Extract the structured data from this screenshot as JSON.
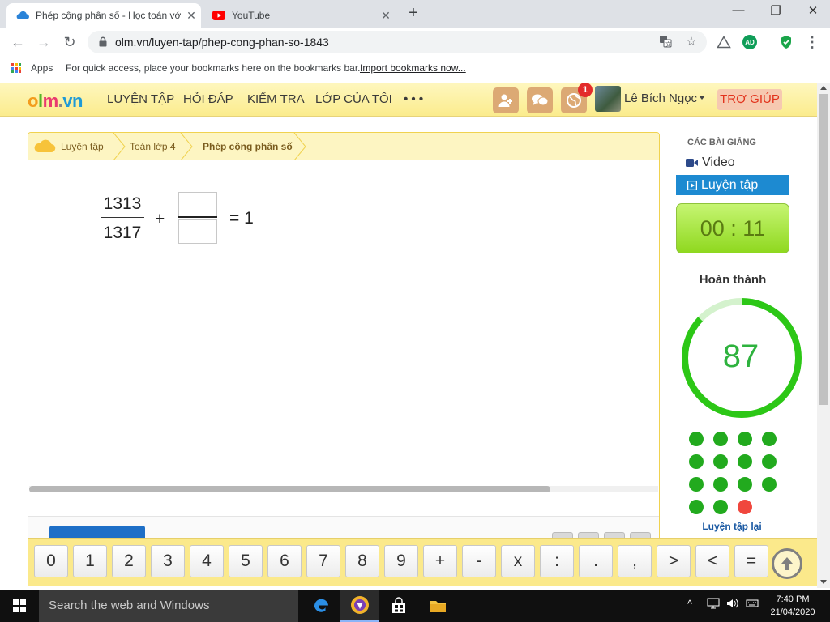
{
  "browser": {
    "tabs": [
      {
        "title": "Phép cộng phân số - Học toán vớ",
        "icon": "cloud-favicon-icon"
      },
      {
        "title": "YouTube",
        "icon": "youtube-favicon-icon"
      }
    ],
    "url": "olm.vn/luyen-tap/phep-cong-phan-so-1843",
    "bookmarks": {
      "apps_label": "Apps",
      "hint": "For quick access, place your bookmarks here on the bookmarks bar.",
      "import_link": "Import bookmarks now..."
    },
    "extensions": [
      "AD"
    ]
  },
  "site": {
    "logo": {
      "o": "o",
      "l": "l",
      "m": "m",
      "dot": ".",
      "vn": "vn"
    },
    "nav": [
      "LUYỆN TẬP",
      "HỎI ĐÁP",
      "KIỂM TRA",
      "LỚP CỦA TÔI",
      "• • •"
    ],
    "notification_count": "1",
    "user_name": "Lê Bích Ngọc",
    "help": "TRỢ GIÚP"
  },
  "breadcrumb": [
    "Luyện tập",
    "Toán lớp 4",
    "Phép cộng phân số"
  ],
  "exercise": {
    "numerator": "1313",
    "denominator": "1317",
    "plus": "+",
    "equals": "= 1",
    "answer_numerator": "",
    "answer_denominator": ""
  },
  "sidebar": {
    "title": "CÁC BÀI GIẢNG",
    "video": "Video",
    "practice": "Luyện tập",
    "timer": "00 : 11",
    "completion_label": "Hoàn thành",
    "score": "87",
    "score_fraction": 0.87,
    "results": [
      "correct",
      "correct",
      "correct",
      "correct",
      "correct",
      "correct",
      "correct",
      "correct",
      "correct",
      "correct",
      "correct",
      "correct",
      "correct",
      "correct",
      "wrong"
    ],
    "retry": "Luyện tập lại"
  },
  "keypad": [
    "0",
    "1",
    "2",
    "3",
    "4",
    "5",
    "6",
    "7",
    "8",
    "9",
    "+",
    "-",
    "x",
    ":",
    ".",
    ",",
    ">",
    "<",
    "="
  ],
  "taskbar": {
    "search": "Search the web and Windows",
    "time": "7:40 PM",
    "date": "21/04/2020"
  },
  "colors": {
    "correct": "#22aa1e",
    "wrong": "#f0473d",
    "ring": "#2cc716",
    "ring_track": "#d4f2cd",
    "accent": "#1d8ad1"
  }
}
